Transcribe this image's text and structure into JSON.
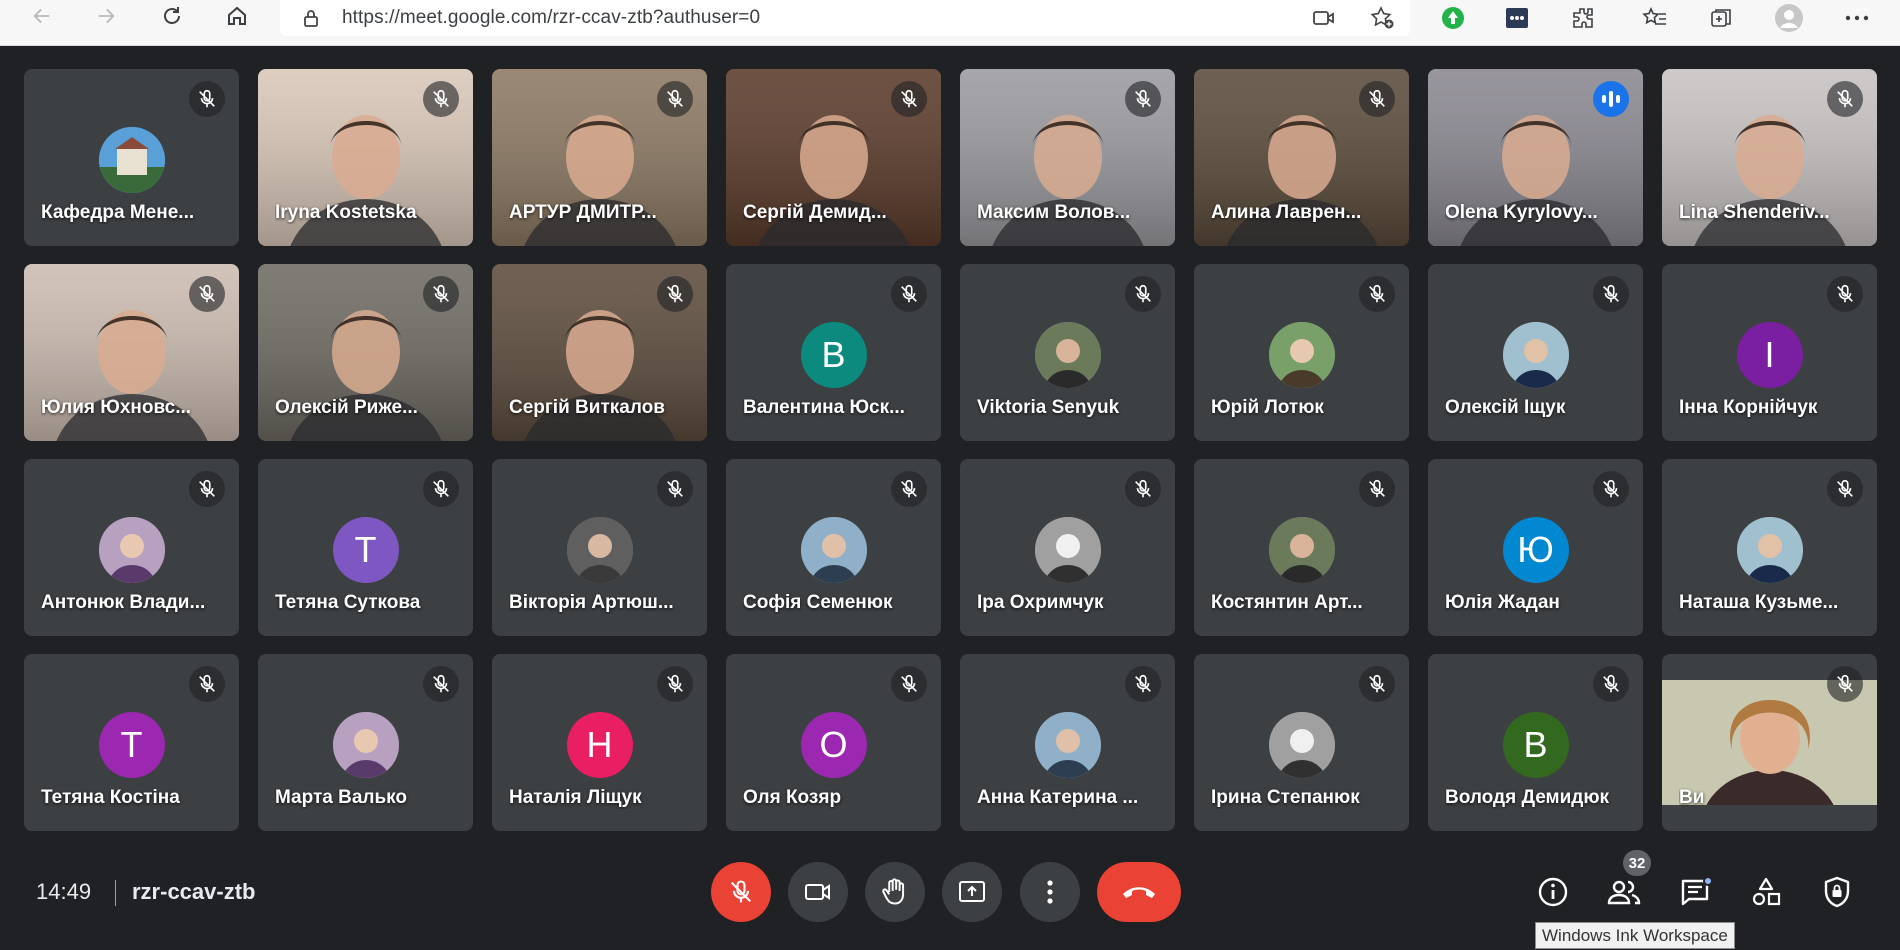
{
  "browser": {
    "url": "https://meet.google.com/rzr-ccav-ztb?authuser=0"
  },
  "participants": [
    {
      "name": "Кафедра Мене...",
      "kind": "logo",
      "muted": true
    },
    {
      "name": "Iryna Kostetska",
      "kind": "video",
      "muted": true,
      "bg": "#d9c7b8"
    },
    {
      "name": "АРТУР ДМИТР...",
      "kind": "video",
      "muted": true,
      "bg": "#8c7862"
    },
    {
      "name": "Сергій Демид...",
      "kind": "video",
      "muted": true,
      "bg": "#5a3a2a"
    },
    {
      "name": "Максим Волов...",
      "kind": "video",
      "muted": true,
      "bg": "#9a9a9f"
    },
    {
      "name": "Алина Лаврен...",
      "kind": "video",
      "muted": true,
      "bg": "#5a4a3a"
    },
    {
      "name": "Olena Kyrylovy...",
      "kind": "video",
      "muted": false,
      "speaking": true,
      "bg": "#8a8790"
    },
    {
      "name": "Lina Shenderiv...",
      "kind": "video",
      "muted": true,
      "bg": "#c8c2c2"
    },
    {
      "name": "Юлия Юхновс...",
      "kind": "video",
      "muted": true,
      "bg": "#cbbbb0"
    },
    {
      "name": "Олексій Риже...",
      "kind": "video",
      "muted": true,
      "bg": "#6e6a63"
    },
    {
      "name": "Сергій Виткалов",
      "kind": "video",
      "muted": true,
      "bg": "#5c4b3c"
    },
    {
      "name": "Валентина Юск...",
      "kind": "letter",
      "letter": "В",
      "color": "#0b8a7d",
      "muted": true
    },
    {
      "name": "Viktoria Senyuk",
      "kind": "photo",
      "muted": true
    },
    {
      "name": "Юрій Лотюк",
      "kind": "photo",
      "muted": true
    },
    {
      "name": "Олексій Іщук",
      "kind": "photo",
      "muted": true
    },
    {
      "name": "Інна Корнійчук",
      "kind": "letter",
      "letter": "І",
      "color": "#7b1fa2",
      "muted": true
    },
    {
      "name": "Антонюк Влади...",
      "kind": "photo",
      "muted": true
    },
    {
      "name": "Тетяна Суткова",
      "kind": "letter",
      "letter": "Т",
      "color": "#7e57c2",
      "muted": true
    },
    {
      "name": "Вікторія Артюш...",
      "kind": "photo",
      "muted": true
    },
    {
      "name": "Софія Семенюк",
      "kind": "photo",
      "muted": true
    },
    {
      "name": "Іра Охримчук",
      "kind": "photo",
      "muted": true
    },
    {
      "name": "Костянтин Арт...",
      "kind": "photo",
      "muted": true
    },
    {
      "name": "Юлія Жадан",
      "kind": "letter",
      "letter": "Ю",
      "color": "#0288d1",
      "muted": true
    },
    {
      "name": "Наташа Кузьме...",
      "kind": "photo",
      "muted": true
    },
    {
      "name": "Тетяна Костіна",
      "kind": "letter",
      "letter": "Т",
      "color": "#9c27b0",
      "muted": true
    },
    {
      "name": "Марта Валько",
      "kind": "photo",
      "muted": true
    },
    {
      "name": "Наталія Ліщук",
      "kind": "letter",
      "letter": "Н",
      "color": "#e91e63",
      "muted": true
    },
    {
      "name": "Оля Козяр",
      "kind": "letter",
      "letter": "О",
      "color": "#9c27b0",
      "muted": true
    },
    {
      "name": "Анна Катерина ...",
      "kind": "photo",
      "muted": true
    },
    {
      "name": "Ірина Степанюк",
      "kind": "photo",
      "muted": true
    },
    {
      "name": "Володя Демидюк",
      "kind": "letter",
      "letter": "В",
      "color": "#33691e",
      "muted": true
    },
    {
      "name": "Ви",
      "kind": "self",
      "muted": true
    }
  ],
  "meeting": {
    "time": "14:49",
    "code": "rzr-ccav-ztb",
    "people_count": "32"
  },
  "tooltip": "Windows Ink Workspace",
  "colors": {
    "background": "#202124",
    "tile": "#3c4043",
    "danger": "#ea4335",
    "accent": "#8ab4f8"
  }
}
